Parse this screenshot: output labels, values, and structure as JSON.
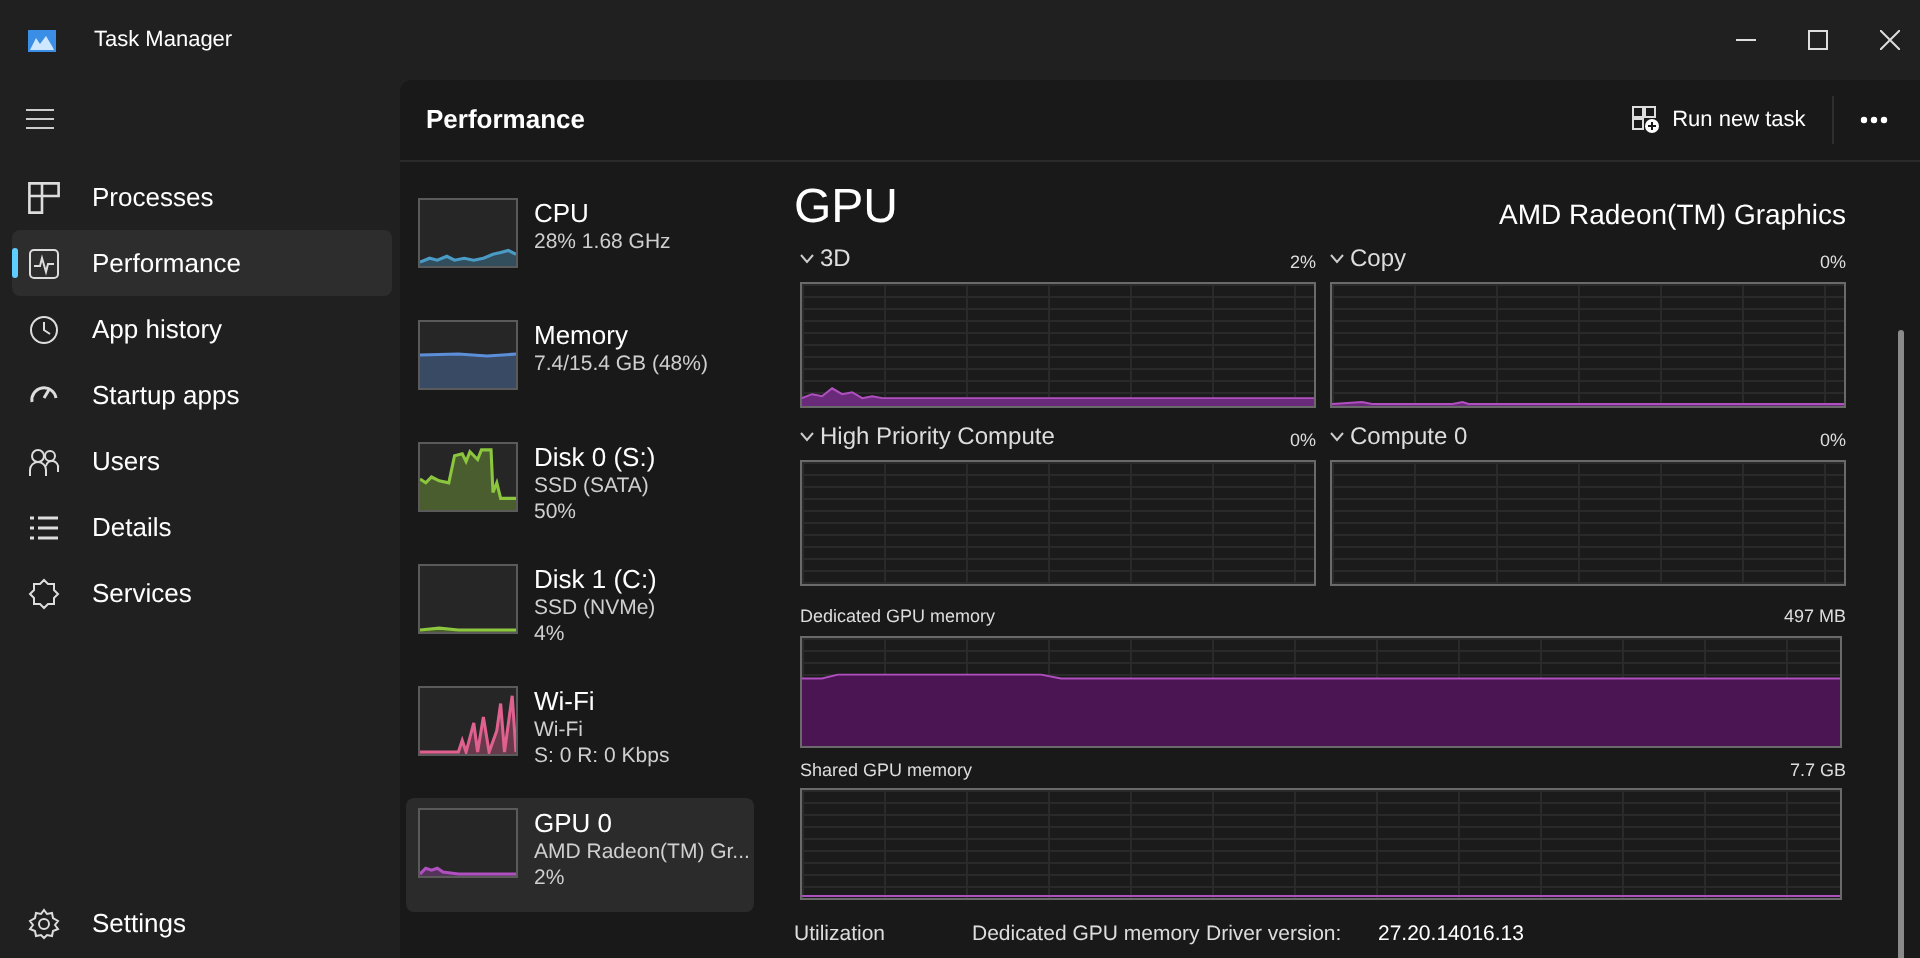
{
  "window": {
    "title": "Task Manager"
  },
  "nav": {
    "items": [
      {
        "label": "Processes",
        "selected": false
      },
      {
        "label": "Performance",
        "selected": true
      },
      {
        "label": "App history",
        "selected": false
      },
      {
        "label": "Startup apps",
        "selected": false
      },
      {
        "label": "Users",
        "selected": false
      },
      {
        "label": "Details",
        "selected": false
      },
      {
        "label": "Services",
        "selected": false
      }
    ],
    "settings": "Settings"
  },
  "header": {
    "title": "Performance",
    "run_task": "Run new task"
  },
  "devices": [
    {
      "name": "CPU",
      "lines": [
        "28%  1.68 GHz"
      ],
      "color": "#4a9cc7",
      "selected": false
    },
    {
      "name": "Memory",
      "lines": [
        "7.4/15.4 GB (48%)"
      ],
      "color": "#5b8fd9",
      "selected": false
    },
    {
      "name": "Disk 0 (S:)",
      "lines": [
        "SSD (SATA)",
        "50%"
      ],
      "color": "#8cc63f",
      "selected": false
    },
    {
      "name": "Disk 1 (C:)",
      "lines": [
        "SSD (NVMe)",
        "4%"
      ],
      "color": "#8cc63f",
      "selected": false
    },
    {
      "name": "Wi-Fi",
      "lines": [
        "Wi-Fi",
        "S: 0 R: 0 Kbps"
      ],
      "color": "#e0608f",
      "selected": false
    },
    {
      "name": "GPU 0",
      "lines": [
        "AMD Radeon(TM) Gr...",
        "2%"
      ],
      "color": "#b04fc0",
      "selected": true
    }
  ],
  "detail": {
    "title": "GPU",
    "device": "AMD Radeon(TM) Graphics",
    "engines": [
      {
        "label": "3D",
        "value": "2%"
      },
      {
        "label": "Copy",
        "value": "0%"
      },
      {
        "label": "High Priority Compute",
        "value": "0%"
      },
      {
        "label": "Compute 0",
        "value": "0%"
      }
    ],
    "memory": [
      {
        "label": "Dedicated GPU memory",
        "value": "497 MB"
      },
      {
        "label": "Shared GPU memory",
        "value": "7.7 GB"
      }
    ],
    "stats": [
      "Utilization",
      "Dedicated GPU memory",
      "Driver version:",
      "27.20.14016.13"
    ]
  }
}
